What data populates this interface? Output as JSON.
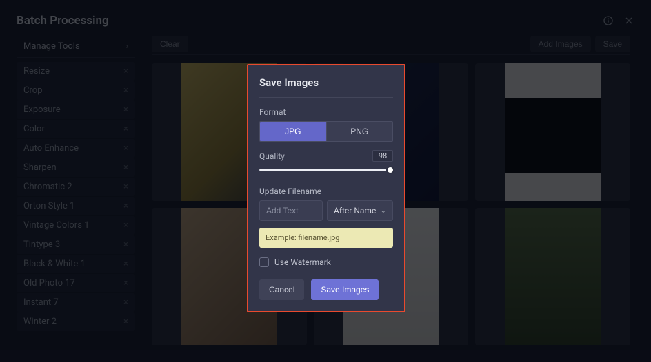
{
  "header": {
    "title": "Batch Processing"
  },
  "sidebar": {
    "manage_label": "Manage Tools",
    "tools": [
      "Resize",
      "Crop",
      "Exposure",
      "Color",
      "Auto Enhance",
      "Sharpen",
      "Chromatic 2",
      "Orton Style 1",
      "Vintage Colors 1",
      "Tintype 3",
      "Black & White 1",
      "Old Photo 17",
      "Instant 7",
      "Winter 2"
    ]
  },
  "toolbar": {
    "clear": "Clear",
    "add_images": "Add Images",
    "save": "Save"
  },
  "modal": {
    "title": "Save Images",
    "format_label": "Format",
    "format_options": {
      "jpg": "JPG",
      "png": "PNG"
    },
    "quality_label": "Quality",
    "quality_value": "98",
    "update_filename_label": "Update Filename",
    "add_text_placeholder": "Add Text",
    "position_selected": "After Name",
    "example_text": "Example: filename.jpg",
    "watermark_label": "Use Watermark",
    "cancel": "Cancel",
    "save_images": "Save Images"
  }
}
